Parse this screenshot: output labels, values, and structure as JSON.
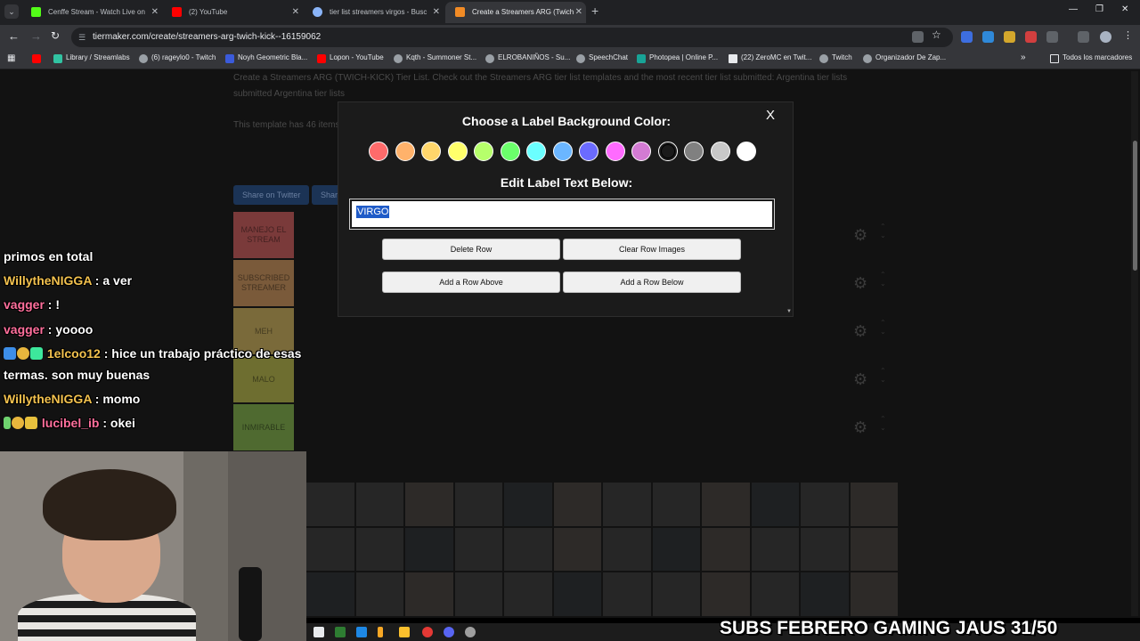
{
  "tabs": [
    {
      "title": "Cenffe Stream - Watch Live on",
      "color": "#53fc18"
    },
    {
      "title": "(2) YouTube",
      "color": "#ff0000"
    },
    {
      "title": "tier list streamers virgos - Busc",
      "color": "#8ab4f8"
    },
    {
      "title": "Create a Streamers ARG (Twich",
      "color": "#f28b25"
    }
  ],
  "address": "tiermaker.com/create/streamers-arg-twich-kick--16159062",
  "bookmarks": [
    "Library / Streamlabs",
    "(6) rageylo0 - Twitch",
    "Noyh Geometric Bla...",
    "Lopon - YouTube",
    "Kqth - Summoner St...",
    "ELROBANIÑOS - Su...",
    "SpeechChat",
    "Photopea | Online P...",
    "(22) ZeroMC en Twit...",
    "Twitch",
    "Organizador De Zap...",
    "Todos los marcadores"
  ],
  "page": {
    "desc_line1": "Create a Streamers ARG (TWICH-KICK) Tier List. Check out the Streamers ARG tier list templates and the most recent tier list submitted: Argentina tier lists",
    "desc_line2": "submitted Argentina tier lists",
    "desc_line3": "This template has 46 items",
    "btn_share": "Share on Twitter",
    "btn_save": "Share",
    "tiers": [
      {
        "label": "MANEJO EL STREAM",
        "color": "#ff7f7f"
      },
      {
        "label": "SUBSCRIBED STREAMER",
        "color": "#ffbf7f"
      },
      {
        "label": "MEH",
        "color": "#ffdf7f"
      },
      {
        "label": "MALO",
        "color": "#ffff7f"
      },
      {
        "label": "INMIRABLE",
        "color": "#bfff7f"
      }
    ]
  },
  "modal": {
    "title": "Choose a Label Background Color:",
    "close": "X",
    "edit_title": "Edit Label Text Below:",
    "label_value": "VIRGO",
    "colors": [
      "#ff6b6b",
      "#ffb26b",
      "#ffd66b",
      "#ffff6b",
      "#b6ff6b",
      "#6bff6b",
      "#6bffff",
      "#6bb6ff",
      "#6b6bff",
      "#ff6bff",
      "#d37bd3",
      "#1a1a1a",
      "#808080",
      "#c8c8c8",
      "#ffffff"
    ],
    "selected_color_index": 11,
    "buttons": {
      "delete_row": "Delete Row",
      "clear_row_images": "Clear Row Images",
      "add_above": "Add a Row Above",
      "add_below": "Add a Row Below"
    }
  },
  "chat": [
    {
      "user": "",
      "user_color": "#ffffff",
      "text": "primos en total"
    },
    {
      "user": "WillytheNIGGA",
      "user_color": "#f2c14e",
      "text": " : a ver"
    },
    {
      "user": "vagger",
      "user_color": "#ff6f9c",
      "text": " : !"
    },
    {
      "user": "vagger",
      "user_color": "#ff6f9c",
      "text": " : yoooo"
    },
    {
      "user": "1elcoo12",
      "user_color": "#f2c14e",
      "text": " : hice un trabajo práctico de esas"
    },
    {
      "user": "",
      "user_color": "#ffffff",
      "text": "termas. son muy buenas"
    },
    {
      "user": "WillytheNIGGA",
      "user_color": "#f2c14e",
      "text": " : momo"
    },
    {
      "user": "lucibel_ib",
      "user_color": "#ff6f9c",
      "text": " : okei"
    }
  ],
  "subs_banner": "SUBS FEBRERO GAMING JAUS 31/50"
}
